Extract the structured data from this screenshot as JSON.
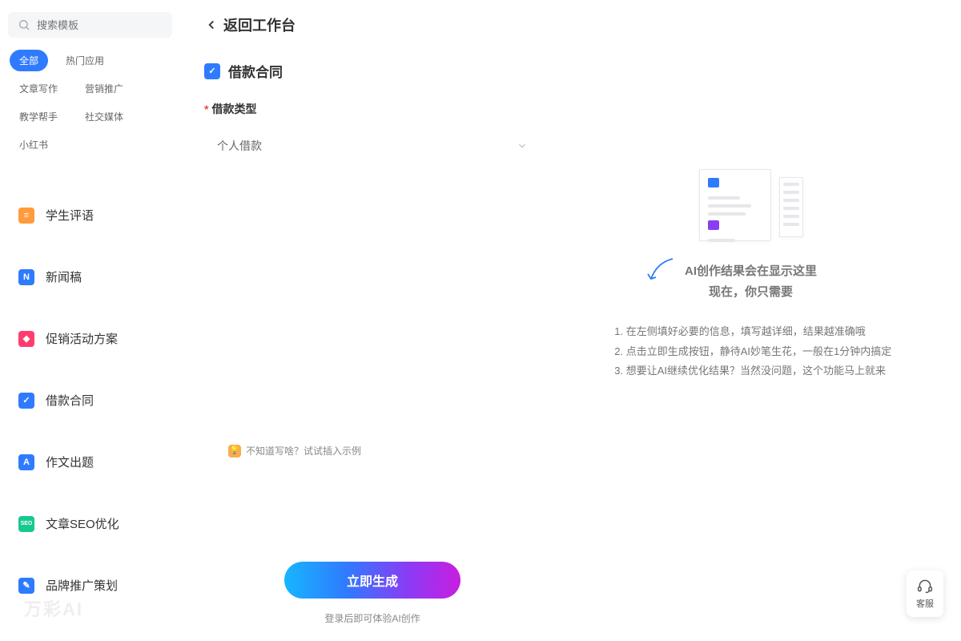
{
  "sidebar": {
    "search_placeholder": "搜索模板",
    "tags": [
      "全部",
      "热门应用",
      "文章写作",
      "营销推广",
      "教学帮手",
      "社交媒体",
      "小红书"
    ],
    "nav": [
      {
        "label": "学生评语",
        "color": "#ff9a3d",
        "glyph": "≡"
      },
      {
        "label": "新闻稿",
        "color": "#2f7bff",
        "glyph": "N"
      },
      {
        "label": "促销活动方案",
        "color": "#ff3d6e",
        "glyph": "◆"
      },
      {
        "label": "借款合同",
        "color": "#2f7bff",
        "glyph": "✓"
      },
      {
        "label": "作文出题",
        "color": "#2f7bff",
        "glyph": "A"
      },
      {
        "label": "文章SEO优化",
        "color": "#18c98f",
        "glyph": "SEO"
      },
      {
        "label": "品牌推广策划",
        "color": "#2f7bff",
        "glyph": "✎"
      }
    ],
    "brand": "万彩AI"
  },
  "header": {
    "back_label": "返回工作台"
  },
  "form": {
    "title": "借款合同",
    "field_label": "借款类型",
    "required_mark": "*",
    "select_value": "个人借款",
    "example_hint": "不知道写啥？试试插入示例",
    "generate_label": "立即生成",
    "login_hint": "登录后即可体验AI创作"
  },
  "result": {
    "title_line1": "AI创作结果会在显示这里",
    "title_line2": "现在，你只需要",
    "steps": [
      "在左侧填好必要的信息，填写越详细，结果越准确哦",
      "点击立即生成按钮，静待AI妙笔生花，一般在1分钟内搞定",
      "想要让AI继续优化结果？当然没问题，这个功能马上就来"
    ]
  },
  "support": {
    "label": "客服"
  }
}
